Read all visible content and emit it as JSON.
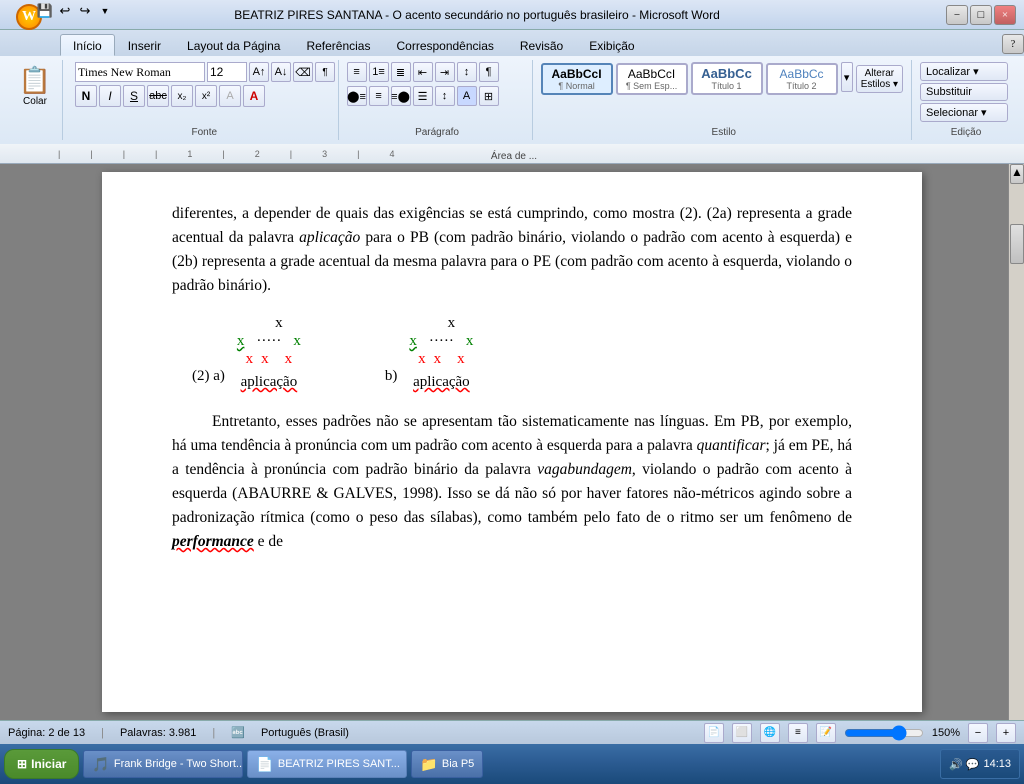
{
  "window": {
    "title": "BEATRIZ PIRES SANTANA - O acento secundário no português brasileiro - Microsoft Word",
    "min_label": "−",
    "max_label": "□",
    "close_label": "×"
  },
  "quick_access": {
    "save": "💾",
    "undo": "↩",
    "redo": "↪"
  },
  "tabs": {
    "items": [
      "Início",
      "Inserir",
      "Layout da Página",
      "Referências",
      "Correspondências",
      "Revisão",
      "Exibição"
    ],
    "active": 0
  },
  "ribbon": {
    "clipboard_label": "Área de ...",
    "font_label": "Fonte",
    "paragraph_label": "Parágrafo",
    "style_label": "Estilo",
    "editing_label": "Edição",
    "colar": "Colar",
    "font_name": "Times New Roman",
    "font_size": "12",
    "bold": "N",
    "italic": "I",
    "underline": "S",
    "strikethrough": "ab",
    "subscript": "x₂",
    "superscript": "x²",
    "format": "A",
    "find": "Localizar ▾",
    "replace": "Substituir",
    "select": "Selecionar ▾",
    "styles": [
      {
        "label": "¶ Normal",
        "sublabel": "AaBbCcI",
        "selected": true
      },
      {
        "label": "¶ Sem Esp...",
        "sublabel": "AaBbCcI",
        "selected": false
      },
      {
        "label": "Título 1",
        "sublabel": "AaBbCc",
        "selected": false
      },
      {
        "label": "Título 2",
        "sublabel": "AaBbCc",
        "selected": false
      }
    ],
    "alterar_estilos": "Alterar\nEstilos"
  },
  "document": {
    "para1": "representa a grade acentual da palavra ",
    "para1_italic": "aplicação",
    "para1_rest": " para o PB (com padrão binário, violando o padrão com acento à esquerda) e (2b) representa a grade acentual da mesma palavra para o PE (com padrão com acento à esquerda, violando o padrão binário).",
    "diagram_label": "(2) a)",
    "diagram_b_label": "b)",
    "word_aplicacao": "aplicação",
    "para2_indent": "Entretanto, esses padrões não se apresentam tão sistematicamente nas línguas. Em PB, por exemplo, há uma tendência à pronúncia com um padrão com acento à esquerda para a palavra ",
    "para2_italic": "quantificar",
    "para2_rest": "; já em PE, há a tendência à pronúncia com padrão binário da palavra ",
    "para2_italic2": "vagabundagem",
    "para2_rest2": ", violando o padrão com acento à esquerda (ABAURRE & GALVES, 1998). Isso se dá não só por haver fatores não-métricos agindo sobre a padronização rítmica (como o peso das sílabas), como também pelo fato de o ritmo ser um fenômeno de ",
    "para2_italic3": "performance",
    "para2_rest3": " e de"
  },
  "status": {
    "page": "Página: 2 de 13",
    "words": "Palavras: 3.981",
    "language": "Português (Brasil)",
    "zoom": "150%"
  },
  "taskbar": {
    "start": "Iniciar",
    "items": [
      {
        "label": "Frank Bridge - Two Short...",
        "icon": "🎵",
        "active": false
      },
      {
        "label": "BEATRIZ PIRES SANT...",
        "icon": "📄",
        "active": true
      },
      {
        "label": "Bia P5",
        "icon": "📁",
        "active": false
      }
    ],
    "time": "14:13",
    "tray_icons": "🔊 💬"
  }
}
